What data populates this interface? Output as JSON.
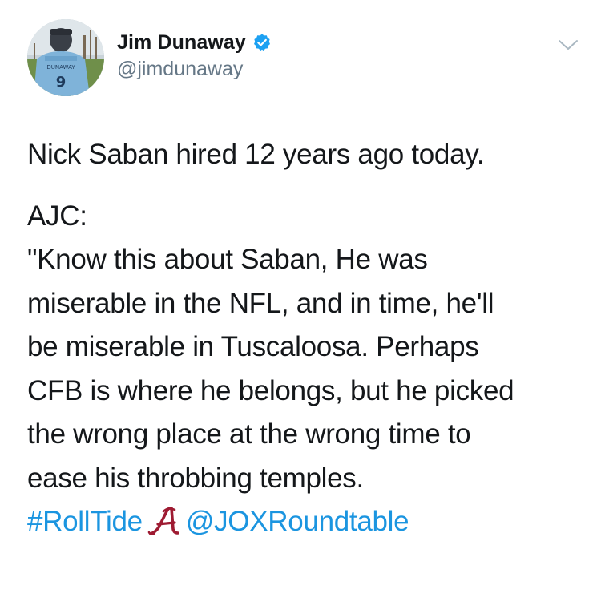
{
  "author": {
    "display_name": "Jim Dunaway",
    "handle": "@jimdunaway",
    "verified": true,
    "avatar_jersey_name": "DUNAWAY",
    "avatar_jersey_number": "9"
  },
  "tweet": {
    "lines_block1": [
      "Nick Saban hired 12 years ago today."
    ],
    "lines_block2": [
      "AJC:",
      "\"Know this about Saban, He was",
      "miserable in the NFL, and in time, he'll",
      "be miserable in Tuscaloosa. Perhaps",
      "CFB is where he belongs, but he picked",
      "the wrong place at the wrong time to",
      "ease his throbbing temples."
    ],
    "hashtag": "#RollTide",
    "emoji": "alabama-script-a-icon",
    "mention": "@JOXRoundtable"
  },
  "colors": {
    "link": "#1b95e0",
    "text": "#14171a",
    "muted": "#657786",
    "verified": "#1da1f2",
    "crimson": "#9e1b32"
  }
}
